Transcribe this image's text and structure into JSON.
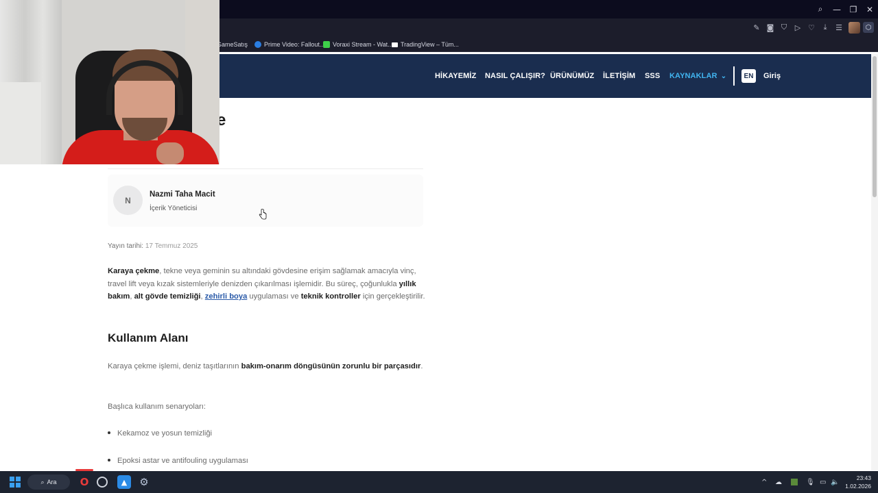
{
  "browser": {
    "bookmarks": [
      {
        "label": "GameSatış",
        "color": "#f0a030"
      },
      {
        "label": "Prime Video: Fallout...",
        "color": "#2a7de1"
      },
      {
        "label": "Voraxi Stream - Wat...",
        "color": "#3ecf4a"
      },
      {
        "label": "TradingView – Tüm...",
        "color": "#ffffff"
      }
    ],
    "toolbar_icons": [
      "edit-icon",
      "camera-icon",
      "shield-icon",
      "play-icon",
      "heart-icon",
      "download-icon",
      "menu-icon",
      "profile-avatar",
      "extension-icon"
    ],
    "window_controls": [
      "search-icon",
      "minimize-icon",
      "restore-icon",
      "close-icon"
    ]
  },
  "site": {
    "nav": [
      {
        "label": "HİKAYEMİZ"
      },
      {
        "label": "NASIL ÇALIŞIR?"
      },
      {
        "label": "ÜRÜNÜMÜZ"
      },
      {
        "label": "İLETİŞİM"
      },
      {
        "label": "SSS"
      },
      {
        "label": "KAYNAKLAR"
      }
    ],
    "nav_dropdown_glyph": "⌄",
    "lang": "EN",
    "login": "Giriş",
    "accent": "#41b4f0",
    "header_bg": "#1a2d4f"
  },
  "article": {
    "title_visible": "e",
    "author": {
      "initial": "N",
      "name": "Nazmi Taha Macit",
      "role": "İçerik Yöneticisi"
    },
    "published_label": "Yayın tarihi:",
    "published_date": "17 Temmuz 2025",
    "intro": {
      "b1": "Karaya çekme",
      "t1": ", tekne veya geminin su altındaki gövdesine erişim sağlamak amacıyla vinç, travel lift veya kızak sistemleriyle denizden çıkarılması işlemidir. Bu süreç, çoğunlukla ",
      "b2": "yıllık bakım",
      "t2": ", ",
      "b3": "alt gövde temizliği",
      "t3": ", ",
      "link": "zehirli boya",
      "t4": " uygulaması ve ",
      "b4": "teknik kontroller",
      "t5": " için gerçekleştirilir."
    },
    "section_heading": "Kullanım Alanı",
    "usage": {
      "t1": "Karaya çekme işlemi, deniz taşıtlarının ",
      "b1": "bakım-onarım döngüsünün zorunlu bir parçasıdır",
      "t2": "."
    },
    "scenarios_label": "Başlıca kullanım senaryoları:",
    "scenarios": [
      "Kekamoz ve yosun temizliği",
      "Epoksi astar ve antifouling uygulaması"
    ]
  },
  "taskbar": {
    "search_label": "Ara",
    "apps": [
      "opera-icon",
      "chrome-dev-icon",
      "photos-icon",
      "settings-icon"
    ],
    "tray": [
      "chevron-up-icon",
      "onedrive-icon",
      "app-tray-icon",
      "mic-icon",
      "display-icon",
      "volume-icon"
    ],
    "time": "23:43",
    "date": "1.02.2026"
  }
}
